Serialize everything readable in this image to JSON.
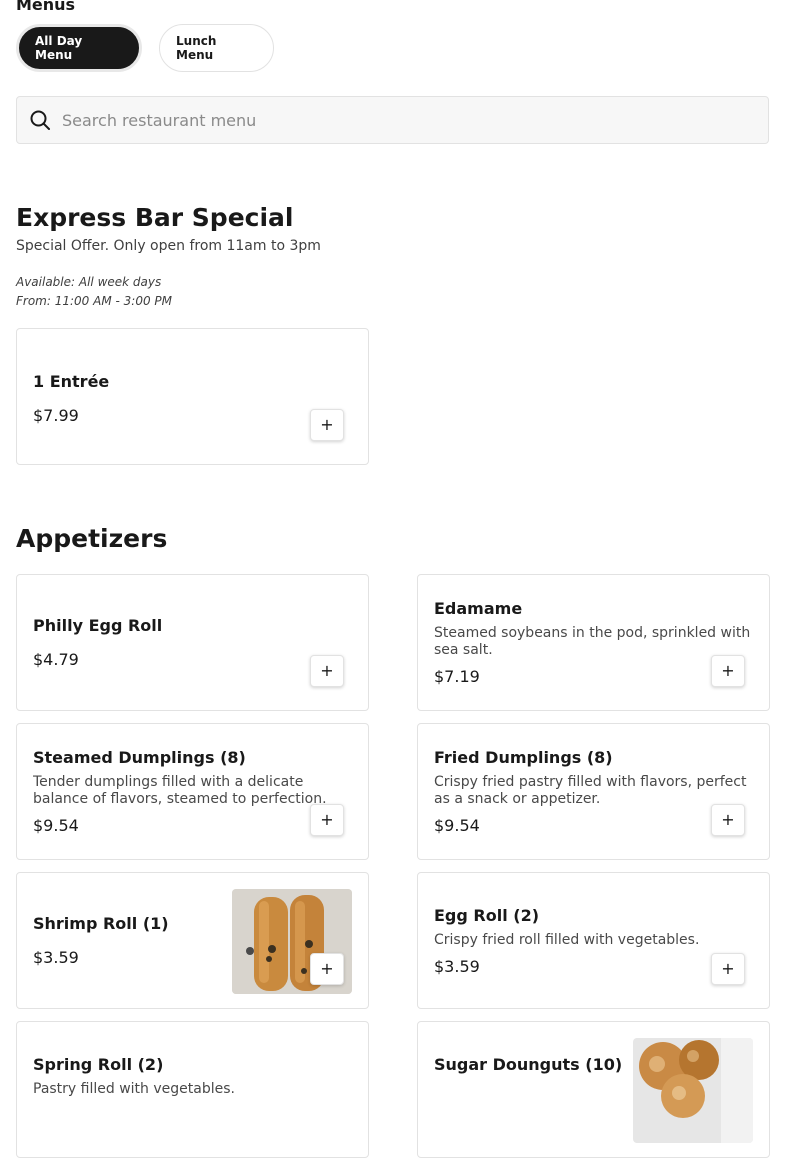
{
  "menus_label": "Menus",
  "tabs": [
    {
      "label": "All Day Menu",
      "active": true
    },
    {
      "label": "Lunch Menu",
      "active": false
    }
  ],
  "search": {
    "placeholder": "Search restaurant menu",
    "value": ""
  },
  "add_icon": "+",
  "sections": [
    {
      "title": "Express Bar Special",
      "description": "Special Offer. Only open from 11am to 3pm",
      "available": "Available: All week days",
      "hours": "From: 11:00 AM - 3:00 PM",
      "items": [
        {
          "name": "1 Entrée",
          "price": "$7.99"
        }
      ]
    },
    {
      "title": "Appetizers",
      "items": [
        {
          "name": "Philly Egg Roll",
          "price": "$4.79"
        },
        {
          "name": "Edamame",
          "description": "Steamed soybeans in the pod, sprinkled with sea salt.",
          "price": "$7.19"
        },
        {
          "name": "Steamed Dumplings (8)",
          "description": "Tender dumplings filled with a delicate balance of flavors, steamed to perfection.",
          "price": "$9.54"
        },
        {
          "name": "Fried Dumplings (8)",
          "description": "Crispy fried pastry filled with flavors, perfect as a snack or appetizer.",
          "price": "$9.54"
        },
        {
          "name": "Shrimp Roll (1)",
          "price": "$3.59",
          "image": "shrimp-roll-photo"
        },
        {
          "name": "Egg Roll (2)",
          "description": "Crispy fried roll filled with vegetables.",
          "price": "$3.59"
        },
        {
          "name": "Spring Roll (2)",
          "description": "Pastry filled with vegetables.",
          "price": ""
        },
        {
          "name": "Sugar Dounguts (10)",
          "price": "",
          "image": "sugar-donuts-photo"
        }
      ]
    }
  ],
  "colors": {
    "text": "#191919",
    "active_tab": "#191919",
    "border": "#e2e2e2",
    "search_bg": "#f7f7f7"
  }
}
